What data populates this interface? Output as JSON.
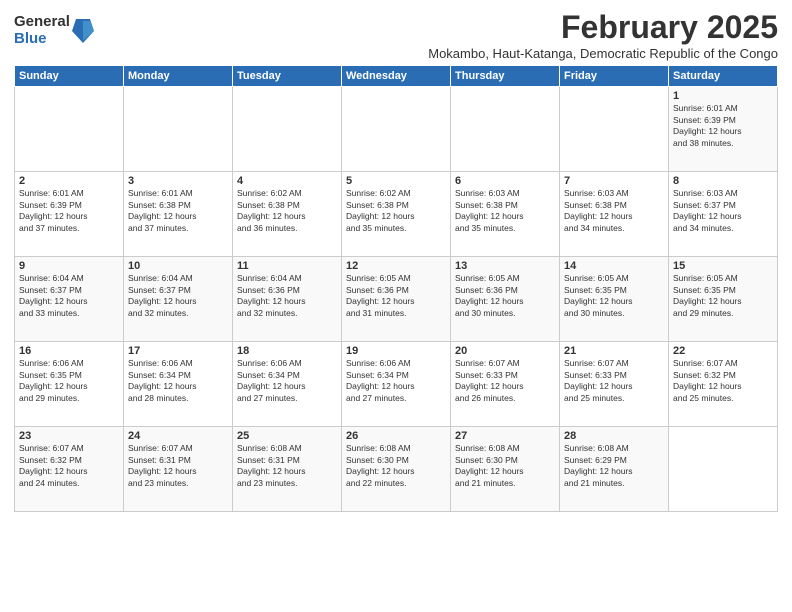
{
  "logo": {
    "general": "General",
    "blue": "Blue"
  },
  "title": "February 2025",
  "subtitle": "Mokambo, Haut-Katanga, Democratic Republic of the Congo",
  "days_of_week": [
    "Sunday",
    "Monday",
    "Tuesday",
    "Wednesday",
    "Thursday",
    "Friday",
    "Saturday"
  ],
  "weeks": [
    [
      {
        "day": "",
        "info": ""
      },
      {
        "day": "",
        "info": ""
      },
      {
        "day": "",
        "info": ""
      },
      {
        "day": "",
        "info": ""
      },
      {
        "day": "",
        "info": ""
      },
      {
        "day": "",
        "info": ""
      },
      {
        "day": "1",
        "info": "Sunrise: 6:01 AM\nSunset: 6:39 PM\nDaylight: 12 hours\nand 38 minutes."
      }
    ],
    [
      {
        "day": "2",
        "info": "Sunrise: 6:01 AM\nSunset: 6:39 PM\nDaylight: 12 hours\nand 37 minutes."
      },
      {
        "day": "3",
        "info": "Sunrise: 6:01 AM\nSunset: 6:38 PM\nDaylight: 12 hours\nand 37 minutes."
      },
      {
        "day": "4",
        "info": "Sunrise: 6:02 AM\nSunset: 6:38 PM\nDaylight: 12 hours\nand 36 minutes."
      },
      {
        "day": "5",
        "info": "Sunrise: 6:02 AM\nSunset: 6:38 PM\nDaylight: 12 hours\nand 35 minutes."
      },
      {
        "day": "6",
        "info": "Sunrise: 6:03 AM\nSunset: 6:38 PM\nDaylight: 12 hours\nand 35 minutes."
      },
      {
        "day": "7",
        "info": "Sunrise: 6:03 AM\nSunset: 6:38 PM\nDaylight: 12 hours\nand 34 minutes."
      },
      {
        "day": "8",
        "info": "Sunrise: 6:03 AM\nSunset: 6:37 PM\nDaylight: 12 hours\nand 34 minutes."
      }
    ],
    [
      {
        "day": "9",
        "info": "Sunrise: 6:04 AM\nSunset: 6:37 PM\nDaylight: 12 hours\nand 33 minutes."
      },
      {
        "day": "10",
        "info": "Sunrise: 6:04 AM\nSunset: 6:37 PM\nDaylight: 12 hours\nand 32 minutes."
      },
      {
        "day": "11",
        "info": "Sunrise: 6:04 AM\nSunset: 6:36 PM\nDaylight: 12 hours\nand 32 minutes."
      },
      {
        "day": "12",
        "info": "Sunrise: 6:05 AM\nSunset: 6:36 PM\nDaylight: 12 hours\nand 31 minutes."
      },
      {
        "day": "13",
        "info": "Sunrise: 6:05 AM\nSunset: 6:36 PM\nDaylight: 12 hours\nand 30 minutes."
      },
      {
        "day": "14",
        "info": "Sunrise: 6:05 AM\nSunset: 6:35 PM\nDaylight: 12 hours\nand 30 minutes."
      },
      {
        "day": "15",
        "info": "Sunrise: 6:05 AM\nSunset: 6:35 PM\nDaylight: 12 hours\nand 29 minutes."
      }
    ],
    [
      {
        "day": "16",
        "info": "Sunrise: 6:06 AM\nSunset: 6:35 PM\nDaylight: 12 hours\nand 29 minutes."
      },
      {
        "day": "17",
        "info": "Sunrise: 6:06 AM\nSunset: 6:34 PM\nDaylight: 12 hours\nand 28 minutes."
      },
      {
        "day": "18",
        "info": "Sunrise: 6:06 AM\nSunset: 6:34 PM\nDaylight: 12 hours\nand 27 minutes."
      },
      {
        "day": "19",
        "info": "Sunrise: 6:06 AM\nSunset: 6:34 PM\nDaylight: 12 hours\nand 27 minutes."
      },
      {
        "day": "20",
        "info": "Sunrise: 6:07 AM\nSunset: 6:33 PM\nDaylight: 12 hours\nand 26 minutes."
      },
      {
        "day": "21",
        "info": "Sunrise: 6:07 AM\nSunset: 6:33 PM\nDaylight: 12 hours\nand 25 minutes."
      },
      {
        "day": "22",
        "info": "Sunrise: 6:07 AM\nSunset: 6:32 PM\nDaylight: 12 hours\nand 25 minutes."
      }
    ],
    [
      {
        "day": "23",
        "info": "Sunrise: 6:07 AM\nSunset: 6:32 PM\nDaylight: 12 hours\nand 24 minutes."
      },
      {
        "day": "24",
        "info": "Sunrise: 6:07 AM\nSunset: 6:31 PM\nDaylight: 12 hours\nand 23 minutes."
      },
      {
        "day": "25",
        "info": "Sunrise: 6:08 AM\nSunset: 6:31 PM\nDaylight: 12 hours\nand 23 minutes."
      },
      {
        "day": "26",
        "info": "Sunrise: 6:08 AM\nSunset: 6:30 PM\nDaylight: 12 hours\nand 22 minutes."
      },
      {
        "day": "27",
        "info": "Sunrise: 6:08 AM\nSunset: 6:30 PM\nDaylight: 12 hours\nand 21 minutes."
      },
      {
        "day": "28",
        "info": "Sunrise: 6:08 AM\nSunset: 6:29 PM\nDaylight: 12 hours\nand 21 minutes."
      },
      {
        "day": "",
        "info": ""
      }
    ]
  ]
}
